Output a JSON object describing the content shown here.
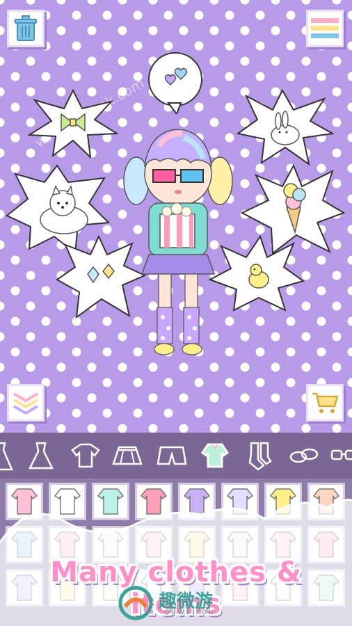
{
  "caption": "Many clothes & items",
  "watermark": "www.520apk.com",
  "brand": {
    "title": "趣微游",
    "subtitle": "QUWEIYOU"
  },
  "colors": {
    "background": "#b79be8",
    "toolbar": "#7a6796",
    "grid": "#8d7da8",
    "caption": "#ff8fc6",
    "accent_shadow": "#9a7fd1"
  },
  "top_bar": {
    "left_icon": "trash-icon",
    "right_icon": "menu-icon"
  },
  "bottom_bar": {
    "left_icon": "collapse-chevrons-icon",
    "right_icon": "shopping-cart-icon"
  },
  "thought_bubble": {
    "icon": "hearts-icon"
  },
  "sticker_items": [
    "bow-icon",
    "bunny-icon",
    "puppy-icon",
    "ice-cream-icon",
    "gems-icon",
    "chick-icon"
  ],
  "tabs": [
    "long-dress-icon",
    "dress-icon",
    "tshirt-icon",
    "skirt-icon",
    "shorts-icon",
    "tops-icon",
    "socks-icon",
    "shoes-icon",
    "glasses-icon"
  ],
  "selected_tab": "tops-icon",
  "grid_items": [
    "pink-sweater",
    "white-vest",
    "mint-jacket",
    "pink-cardigan",
    "purple-hoodie",
    "lavender-top",
    "yellow-top",
    "peach-top",
    "blue-shirt",
    "pink-shirt",
    "white-tee",
    "pink-sweater",
    "yellow-blouse",
    "white-shirt",
    "pink-dress",
    "pink-coat",
    "lavender-tee",
    "yellow-tee",
    "cream-top",
    "white-top",
    "lavender-blouse",
    "pink-vest",
    "white-cape",
    "mint-top"
  ]
}
